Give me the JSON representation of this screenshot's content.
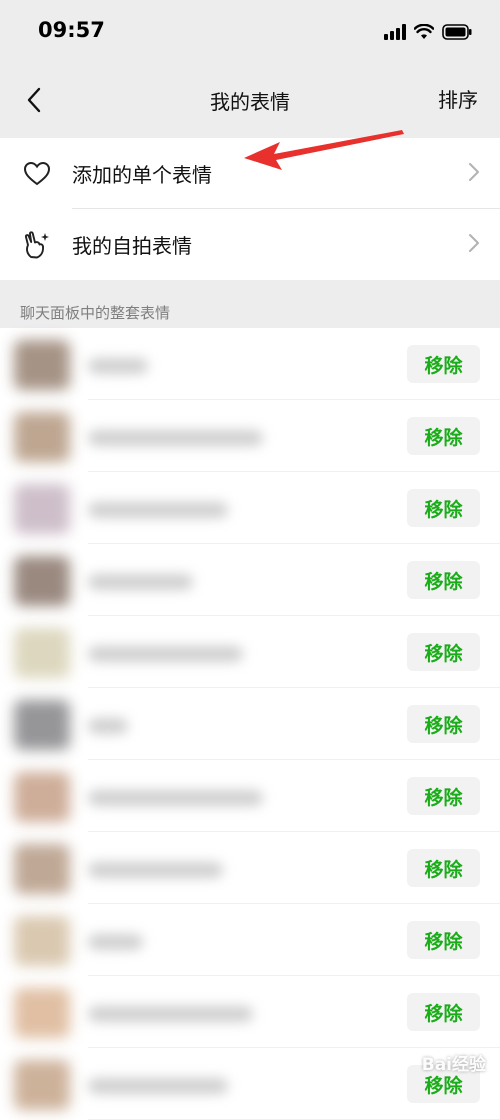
{
  "status": {
    "time": "09:57"
  },
  "nav": {
    "title": "我的表情",
    "sort_label": "排序"
  },
  "menu": [
    {
      "label": "添加的单个表情",
      "icon": "heart-icon"
    },
    {
      "label": "我的自拍表情",
      "icon": "selfie-hand-icon"
    }
  ],
  "section": {
    "title": "聊天面板中的整套表情"
  },
  "list": {
    "remove_label": "移除",
    "rows": [
      {
        "thumb_color": "#9c8878"
      },
      {
        "thumb_color": "#b79d86"
      },
      {
        "thumb_color": "#c9b8c4"
      },
      {
        "thumb_color": "#8f7d72"
      },
      {
        "thumb_color": "#d9d3b8"
      },
      {
        "thumb_color": "#8b8b8e"
      },
      {
        "thumb_color": "#c9a58e"
      },
      {
        "thumb_color": "#b99f8b"
      },
      {
        "thumb_color": "#d6c3a8"
      },
      {
        "thumb_color": "#ddb99a"
      },
      {
        "thumb_color": "#c8aa90"
      }
    ]
  },
  "colors": {
    "accent": "#1aad19",
    "annotation_arrow": "#e8302c"
  },
  "watermark": "Bai经验"
}
